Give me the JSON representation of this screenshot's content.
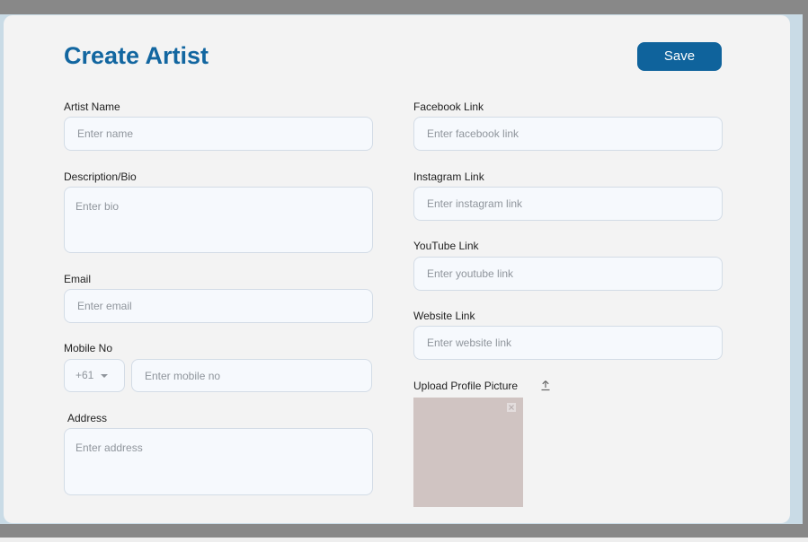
{
  "page": {
    "title": "Create Artist",
    "save_label": "Save"
  },
  "form": {
    "artist_name": {
      "label": "Artist Name",
      "placeholder": "Enter name"
    },
    "bio": {
      "label": "Description/Bio",
      "placeholder": "Enter bio"
    },
    "email": {
      "label": "Email",
      "placeholder": "Enter email"
    },
    "mobile": {
      "label": "Mobile No",
      "country_code": "+61",
      "placeholder": "Enter mobile no"
    },
    "address": {
      "label": "Address",
      "placeholder": "Enter address"
    },
    "facebook": {
      "label": "Facebook Link",
      "placeholder": "Enter facebook link"
    },
    "instagram": {
      "label": "Instagram Link",
      "placeholder": "Enter instagram link"
    },
    "youtube": {
      "label": "YouTube Link",
      "placeholder": "Enter youtube link"
    },
    "website": {
      "label": "Website Link",
      "placeholder": "Enter website link"
    },
    "upload": {
      "label": "Upload Profile Picture",
      "icon": "upload-icon",
      "remove_icon": "close-icon"
    }
  },
  "colors": {
    "accent": "#1266a0",
    "button": "#0f639c",
    "input_bg": "#f6f9fd",
    "preview": "#d0c4c2"
  }
}
